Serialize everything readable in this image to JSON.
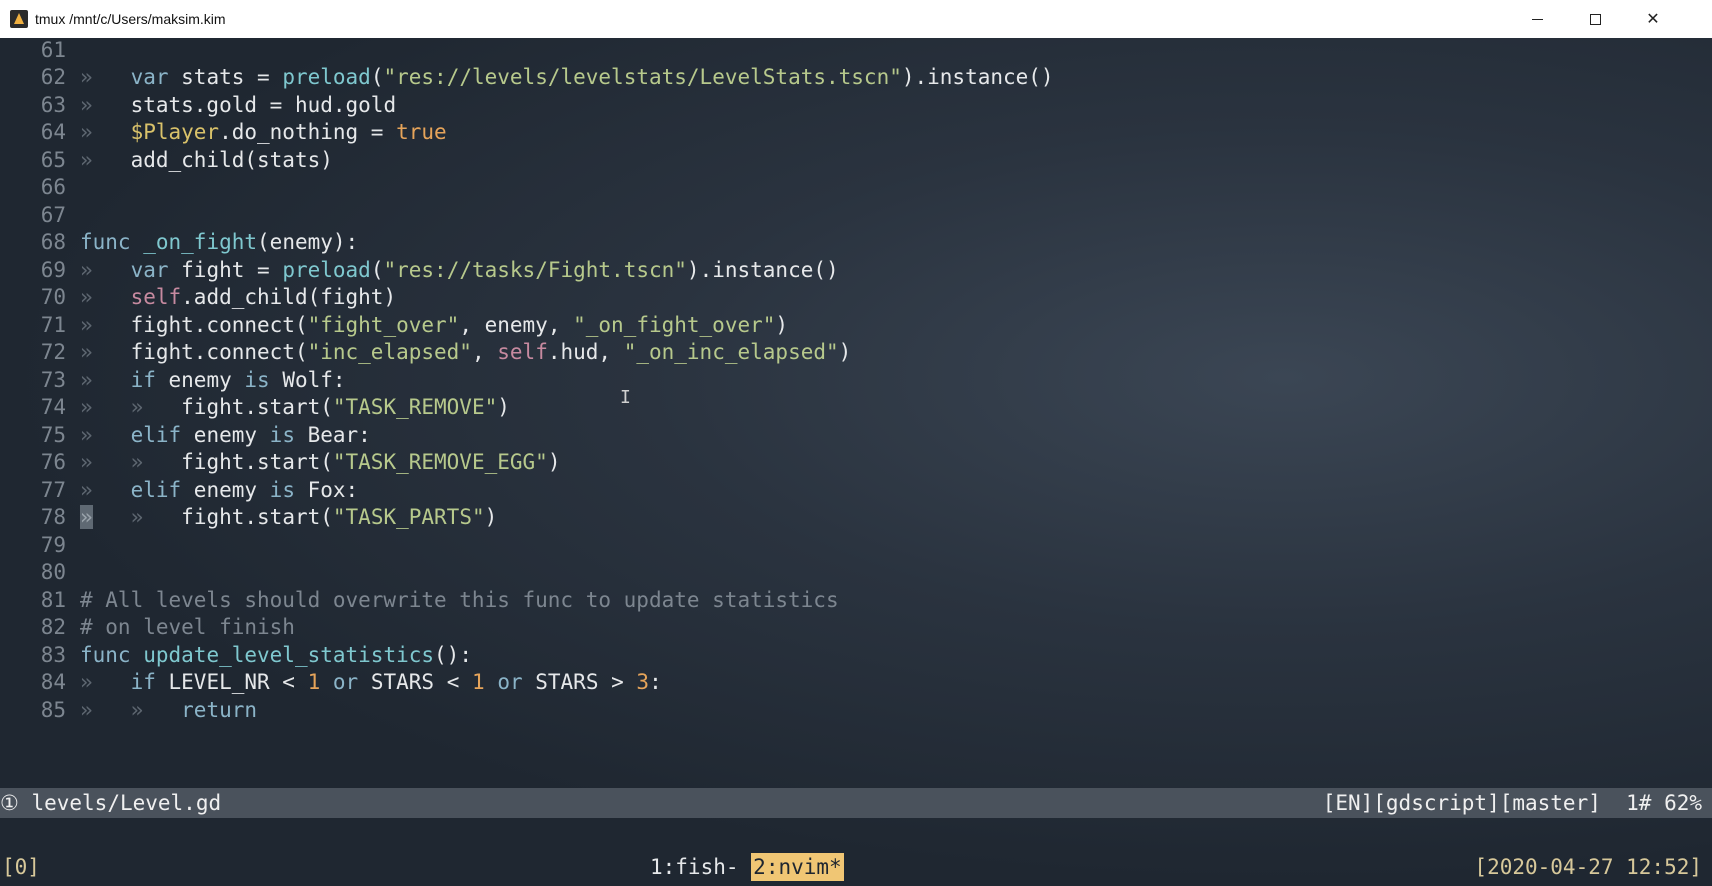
{
  "window": {
    "title": "tmux /mnt/c/Users/maksim.kim",
    "buttons": {
      "minimize": "minimize",
      "maximize": "maximize",
      "close": "✕"
    }
  },
  "editor": {
    "lines": [
      {
        "n": "61",
        "c": ""
      },
      {
        "n": "62",
        "c": "var stats = preload(\"res://levels/levelstats/LevelStats.tscn\").instance()"
      },
      {
        "n": "63",
        "c": "stats.gold = hud.gold"
      },
      {
        "n": "64",
        "c": "$Player.do_nothing = true"
      },
      {
        "n": "65",
        "c": "add_child(stats)"
      },
      {
        "n": "66",
        "c": ""
      },
      {
        "n": "67",
        "c": ""
      },
      {
        "n": "68",
        "c": "func _on_fight(enemy):"
      },
      {
        "n": "69",
        "c": "var fight = preload(\"res://tasks/Fight.tscn\").instance()"
      },
      {
        "n": "70",
        "c": "self.add_child(fight)"
      },
      {
        "n": "71",
        "c": "fight.connect(\"fight_over\", enemy, \"_on_fight_over\")"
      },
      {
        "n": "72",
        "c": "fight.connect(\"inc_elapsed\", self.hud, \"_on_inc_elapsed\")"
      },
      {
        "n": "73",
        "c": "if enemy is Wolf:"
      },
      {
        "n": "74",
        "c": "fight.start(\"TASK_REMOVE\")"
      },
      {
        "n": "75",
        "c": "elif enemy is Bear:"
      },
      {
        "n": "76",
        "c": "fight.start(\"TASK_REMOVE_EGG\")"
      },
      {
        "n": "77",
        "c": "elif enemy is Fox:"
      },
      {
        "n": "78",
        "c": "fight.start(\"TASK_PARTS\")"
      },
      {
        "n": "79",
        "c": ""
      },
      {
        "n": "80",
        "c": ""
      },
      {
        "n": "81",
        "c": "# All levels should overwrite this func to update statistics"
      },
      {
        "n": "82",
        "c": "# on level finish"
      },
      {
        "n": "83",
        "c": "func update_level_statistics():"
      },
      {
        "n": "84",
        "c": "if LEVEL_NR < 1 or STARS < 1 or STARS > 3:"
      },
      {
        "n": "85",
        "c": "return"
      }
    ]
  },
  "statusline": {
    "left": "① levels/Level.gd",
    "right": "[EN][gdscript][master]  1# 62%"
  },
  "tmux": {
    "session": "[0]",
    "window1": "1:fish-",
    "window2": "2:nvim*",
    "clock": "[2020-04-27 12:52]"
  },
  "colors": {
    "background": "#1e2630",
    "statusline": "#4a525c",
    "tmux_active": "#f0c674",
    "keyword": "#8bb4c8",
    "string": "#b7c98c",
    "number": "#e6a45a",
    "comment": "#7d8690"
  }
}
